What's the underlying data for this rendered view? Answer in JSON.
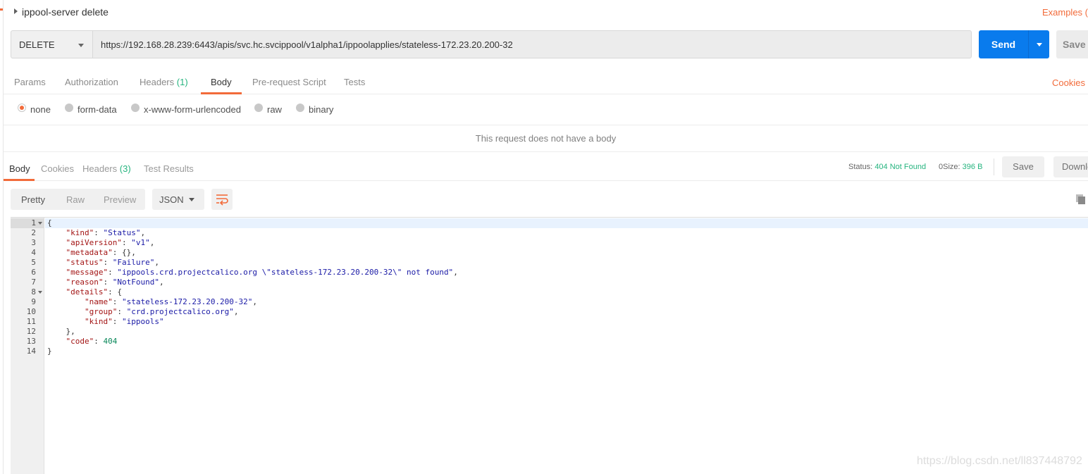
{
  "request": {
    "title": "ippool-server delete",
    "examples_label": "Examples (",
    "method": "DELETE",
    "url": "https://192.168.28.239:6443/apis/svc.hc.svcippool/v1alpha1/ippoolapplies/stateless-172.23.20.200-32",
    "send_label": "Send",
    "save_label": "Save",
    "tabs": [
      {
        "label": "Params"
      },
      {
        "label": "Authorization"
      },
      {
        "label": "Headers",
        "count": "(1)"
      },
      {
        "label": "Body"
      },
      {
        "label": "Pre-request Script"
      },
      {
        "label": "Tests"
      }
    ],
    "active_tab": "Body",
    "cookies_label": "Cookies",
    "body_types": [
      {
        "label": "none",
        "selected": true
      },
      {
        "label": "form-data",
        "selected": false
      },
      {
        "label": "x-www-form-urlencoded",
        "selected": false
      },
      {
        "label": "raw",
        "selected": false
      },
      {
        "label": "binary",
        "selected": false
      }
    ],
    "no_body_message": "This request does not have a body"
  },
  "response": {
    "tabs": [
      {
        "label": "Body"
      },
      {
        "label": "Cookies"
      },
      {
        "label": "Headers",
        "count": "(3)"
      },
      {
        "label": "Test Results"
      }
    ],
    "status_label": "Status:",
    "status_value": "404 Not Found",
    "time_label": "0",
    "size_label": "Size:",
    "size_value": "396 B",
    "save_label": "Save",
    "download_label": "Download",
    "view_modes": [
      "Pretty",
      "Raw",
      "Preview"
    ],
    "active_view": "Pretty",
    "format": "JSON",
    "line_numbers": [
      "1",
      "2",
      "3",
      "4",
      "5",
      "6",
      "7",
      "8",
      "9",
      "10",
      "11",
      "12",
      "13",
      "14"
    ]
  },
  "json_body": {
    "open_brace": "{",
    "close_brace": "}",
    "kind_key": "\"kind\"",
    "kind_val": "\"Status\"",
    "apiVersion_key": "\"apiVersion\"",
    "apiVersion_val": "\"v1\"",
    "metadata_key": "\"metadata\"",
    "metadata_val": "{},",
    "status_key": "\"status\"",
    "status_val": "\"Failure\"",
    "message_key": "\"message\"",
    "message_val": "\"ippools.crd.projectcalico.org \\\"stateless-172.23.20.200-32\\\" not found\"",
    "reason_key": "\"reason\"",
    "reason_val": "\"NotFound\"",
    "details_key": "\"details\"",
    "details_open": "{",
    "details_name_key": "\"name\"",
    "details_name_val": "\"stateless-172.23.20.200-32\"",
    "details_group_key": "\"group\"",
    "details_group_val": "\"crd.projectcalico.org\"",
    "details_kind_key": "\"kind\"",
    "details_kind_val": "\"ippools\"",
    "details_close": "},",
    "code_key": "\"code\"",
    "code_val": "404"
  },
  "watermark": "https://blog.csdn.net/ll837448792",
  "colors": {
    "accent": "#f26b3a",
    "send": "#097bed",
    "status_ok": "#26b47f"
  }
}
